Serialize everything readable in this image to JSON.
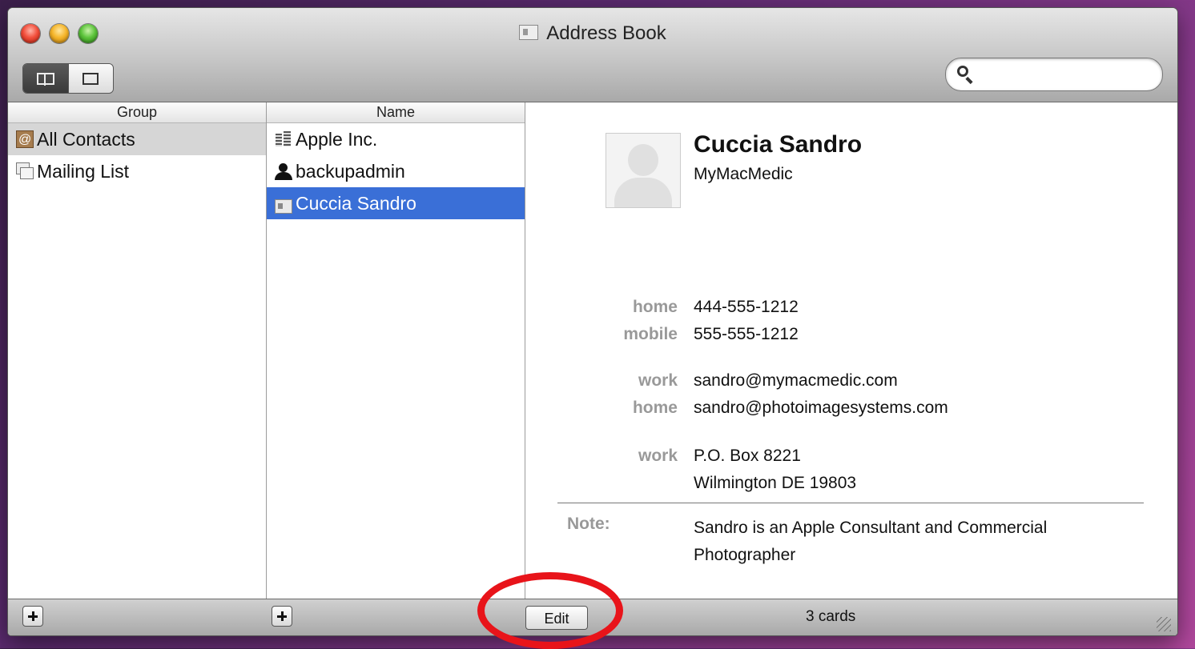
{
  "window": {
    "title": "Address Book"
  },
  "search": {
    "value": "",
    "placeholder": ""
  },
  "groups": {
    "header": "Group",
    "items": [
      {
        "label": "All Contacts",
        "icon": "address-book-icon",
        "selected": true
      },
      {
        "label": "Mailing List",
        "icon": "mailing-list-icon",
        "selected": false
      }
    ]
  },
  "names": {
    "header": "Name",
    "items": [
      {
        "label": "Apple Inc.",
        "icon": "company-icon",
        "selected": false
      },
      {
        "label": "backupadmin",
        "icon": "person-icon",
        "selected": false
      },
      {
        "label": "Cuccia Sandro",
        "icon": "card-icon",
        "selected": true
      }
    ]
  },
  "card": {
    "name": "Cuccia Sandro",
    "company": "MyMacMedic",
    "phones": [
      {
        "label": "home",
        "value": "444-555-1212"
      },
      {
        "label": "mobile",
        "value": "555-555-1212"
      }
    ],
    "emails": [
      {
        "label": "work",
        "value": "sandro@mymacmedic.com"
      },
      {
        "label": "home",
        "value": "sandro@photoimagesystems.com"
      }
    ],
    "address": {
      "label": "work",
      "line1": "P.O. Box 8221",
      "line2": "Wilmington DE 19803"
    },
    "note_label": "Note:",
    "note": "Sandro is an Apple Consultant and Commercial Photographer"
  },
  "bottombar": {
    "edit_label": "Edit",
    "card_count": "3 cards"
  },
  "colors": {
    "selection": "#3a6fd7",
    "annotation": "#e8141a"
  }
}
